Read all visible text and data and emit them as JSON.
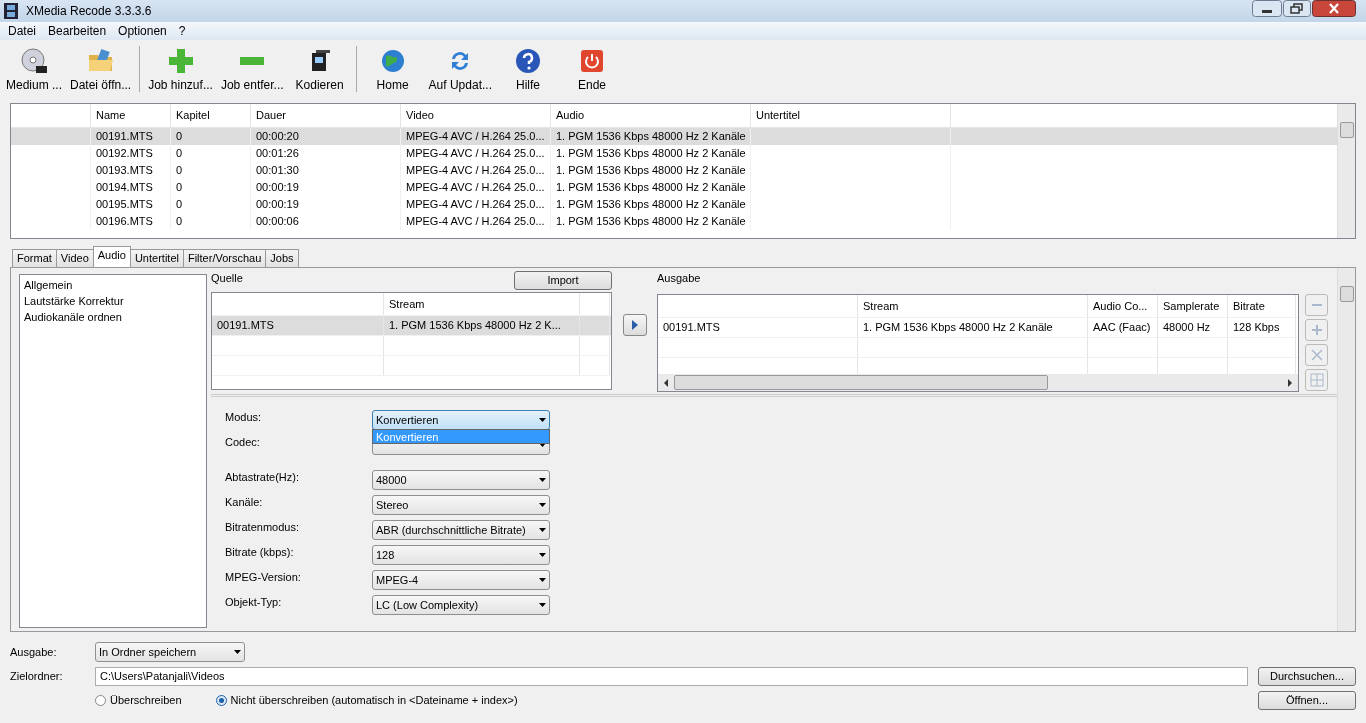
{
  "window": {
    "title": "XMedia Recode 3.3.3.6"
  },
  "menu": [
    "Datei",
    "Bearbeiten",
    "Optionen",
    "?"
  ],
  "toolbar": [
    [
      {
        "label": "Medium ...",
        "kind": "disc"
      },
      {
        "label": "Datei öffn...",
        "kind": "folder"
      }
    ],
    [
      {
        "label": "Job hinzuf...",
        "kind": "plus"
      },
      {
        "label": "Job entfer...",
        "kind": "minus"
      },
      {
        "label": "Kodieren",
        "kind": "encode"
      }
    ],
    [
      {
        "label": "Home",
        "kind": "globe"
      },
      {
        "label": "Auf Updat...",
        "kind": "refresh"
      },
      {
        "label": "Hilfe",
        "kind": "help"
      },
      {
        "label": "Ende",
        "kind": "power"
      }
    ]
  ],
  "file_list": {
    "columns": [
      "Name",
      "Kapitel",
      "Dauer",
      "Video",
      "Audio",
      "Untertitel"
    ],
    "rows": [
      {
        "selected": true,
        "cells": [
          "00191.MTS",
          "0",
          "00:00:20",
          "MPEG-4 AVC / H.264 25.0...",
          "1. PGM 1536 Kbps 48000 Hz 2 Kanäle",
          ""
        ]
      },
      {
        "selected": false,
        "cells": [
          "00192.MTS",
          "0",
          "00:01:26",
          "MPEG-4 AVC / H.264 25.0...",
          "1. PGM 1536 Kbps 48000 Hz 2 Kanäle",
          ""
        ]
      },
      {
        "selected": false,
        "cells": [
          "00193.MTS",
          "0",
          "00:01:30",
          "MPEG-4 AVC / H.264 25.0...",
          "1. PGM 1536 Kbps 48000 Hz 2 Kanäle",
          ""
        ]
      },
      {
        "selected": false,
        "cells": [
          "00194.MTS",
          "0",
          "00:00:19",
          "MPEG-4 AVC / H.264 25.0...",
          "1. PGM 1536 Kbps 48000 Hz 2 Kanäle",
          ""
        ]
      },
      {
        "selected": false,
        "cells": [
          "00195.MTS",
          "0",
          "00:00:19",
          "MPEG-4 AVC / H.264 25.0...",
          "1. PGM 1536 Kbps 48000 Hz 2 Kanäle",
          ""
        ]
      },
      {
        "selected": false,
        "cells": [
          "00196.MTS",
          "0",
          "00:00:06",
          "MPEG-4 AVC / H.264 25.0...",
          "1. PGM 1536 Kbps 48000 Hz 2 Kanäle",
          ""
        ]
      }
    ]
  },
  "tabs": [
    {
      "label": "Format",
      "selected": false
    },
    {
      "label": "Video",
      "selected": false
    },
    {
      "label": "Audio",
      "selected": true
    },
    {
      "label": "Untertitel",
      "selected": false
    },
    {
      "label": "Filter/Vorschau",
      "selected": false
    },
    {
      "label": "Jobs",
      "selected": false
    }
  ],
  "audio": {
    "sections": [
      "Allgemein",
      "Lautstärke Korrektur",
      "Audiokanäle ordnen"
    ],
    "source": {
      "title": "Quelle",
      "import_button": "Import",
      "columns": [
        "",
        "Stream",
        ""
      ],
      "rows": [
        {
          "name": "00191.MTS",
          "stream": "1. PGM 1536 Kbps 48000 Hz 2 K...",
          "selected": true
        }
      ]
    },
    "output": {
      "title": "Ausgabe",
      "columns": [
        "",
        "Stream",
        "Audio Co...",
        "Samplerate",
        "Bitrate"
      ],
      "rows": [
        {
          "cells": [
            "00191.MTS",
            "1. PGM 1536 Kbps 48000 Hz 2 Kanäle",
            "AAC (Faac)",
            "48000 Hz",
            "128 Kbps"
          ]
        }
      ]
    },
    "form": [
      [
        {
          "label": "Modus:",
          "value": "Konvertieren",
          "focused": true
        },
        {
          "label": "Codec:",
          "focused": false
        }
      ],
      [
        {
          "label": "Abtastrate(Hz):",
          "value": "48000",
          "focused": false
        },
        {
          "label": "Kanäle:",
          "value": "Stereo",
          "focused": false
        },
        {
          "label": "Bitratenmodus:",
          "value": "ABR (durchschnittliche Bitrate)",
          "focused": false
        },
        {
          "label": "Bitrate (kbps):",
          "value": "128",
          "focused": false
        },
        {
          "label": "MPEG-Version:",
          "value": "MPEG-4",
          "focused": false
        },
        {
          "label": "Objekt-Typ:",
          "value": "LC (Low Complexity)",
          "focused": false
        }
      ]
    ],
    "open_dropdown": {
      "option": "Konvertieren"
    }
  },
  "bottom": {
    "output_label": "Ausgabe:",
    "output_value": "In Ordner speichern",
    "folder_label": "Zielordner:",
    "folder_path": "C:\\Users\\Patanjali\\Videos",
    "browse_button": "Durchsuchen...",
    "open_button": "Öffnen...",
    "radios": [
      {
        "label": "Überschreiben",
        "selected": false
      },
      {
        "label": "Nicht überschreiben (automatisch in <Dateiname + index>)",
        "selected": true
      }
    ]
  }
}
